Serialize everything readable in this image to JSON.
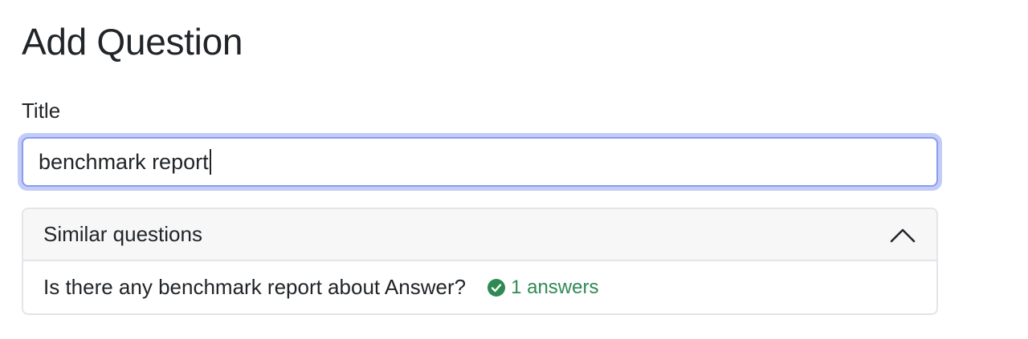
{
  "page": {
    "title": "Add Question"
  },
  "form": {
    "title_label": "Title",
    "title_value": "benchmark report"
  },
  "similar": {
    "header": "Similar questions",
    "items": [
      {
        "question": "Is there any benchmark report about Answer?",
        "answers_text": "1 answers",
        "answered": true
      }
    ]
  },
  "colors": {
    "accent_focus": "#8b9bf0",
    "answered_green": "#2f8a52"
  },
  "icons": {
    "collapse": "chevron-up-icon",
    "answered": "check-circle-icon"
  }
}
